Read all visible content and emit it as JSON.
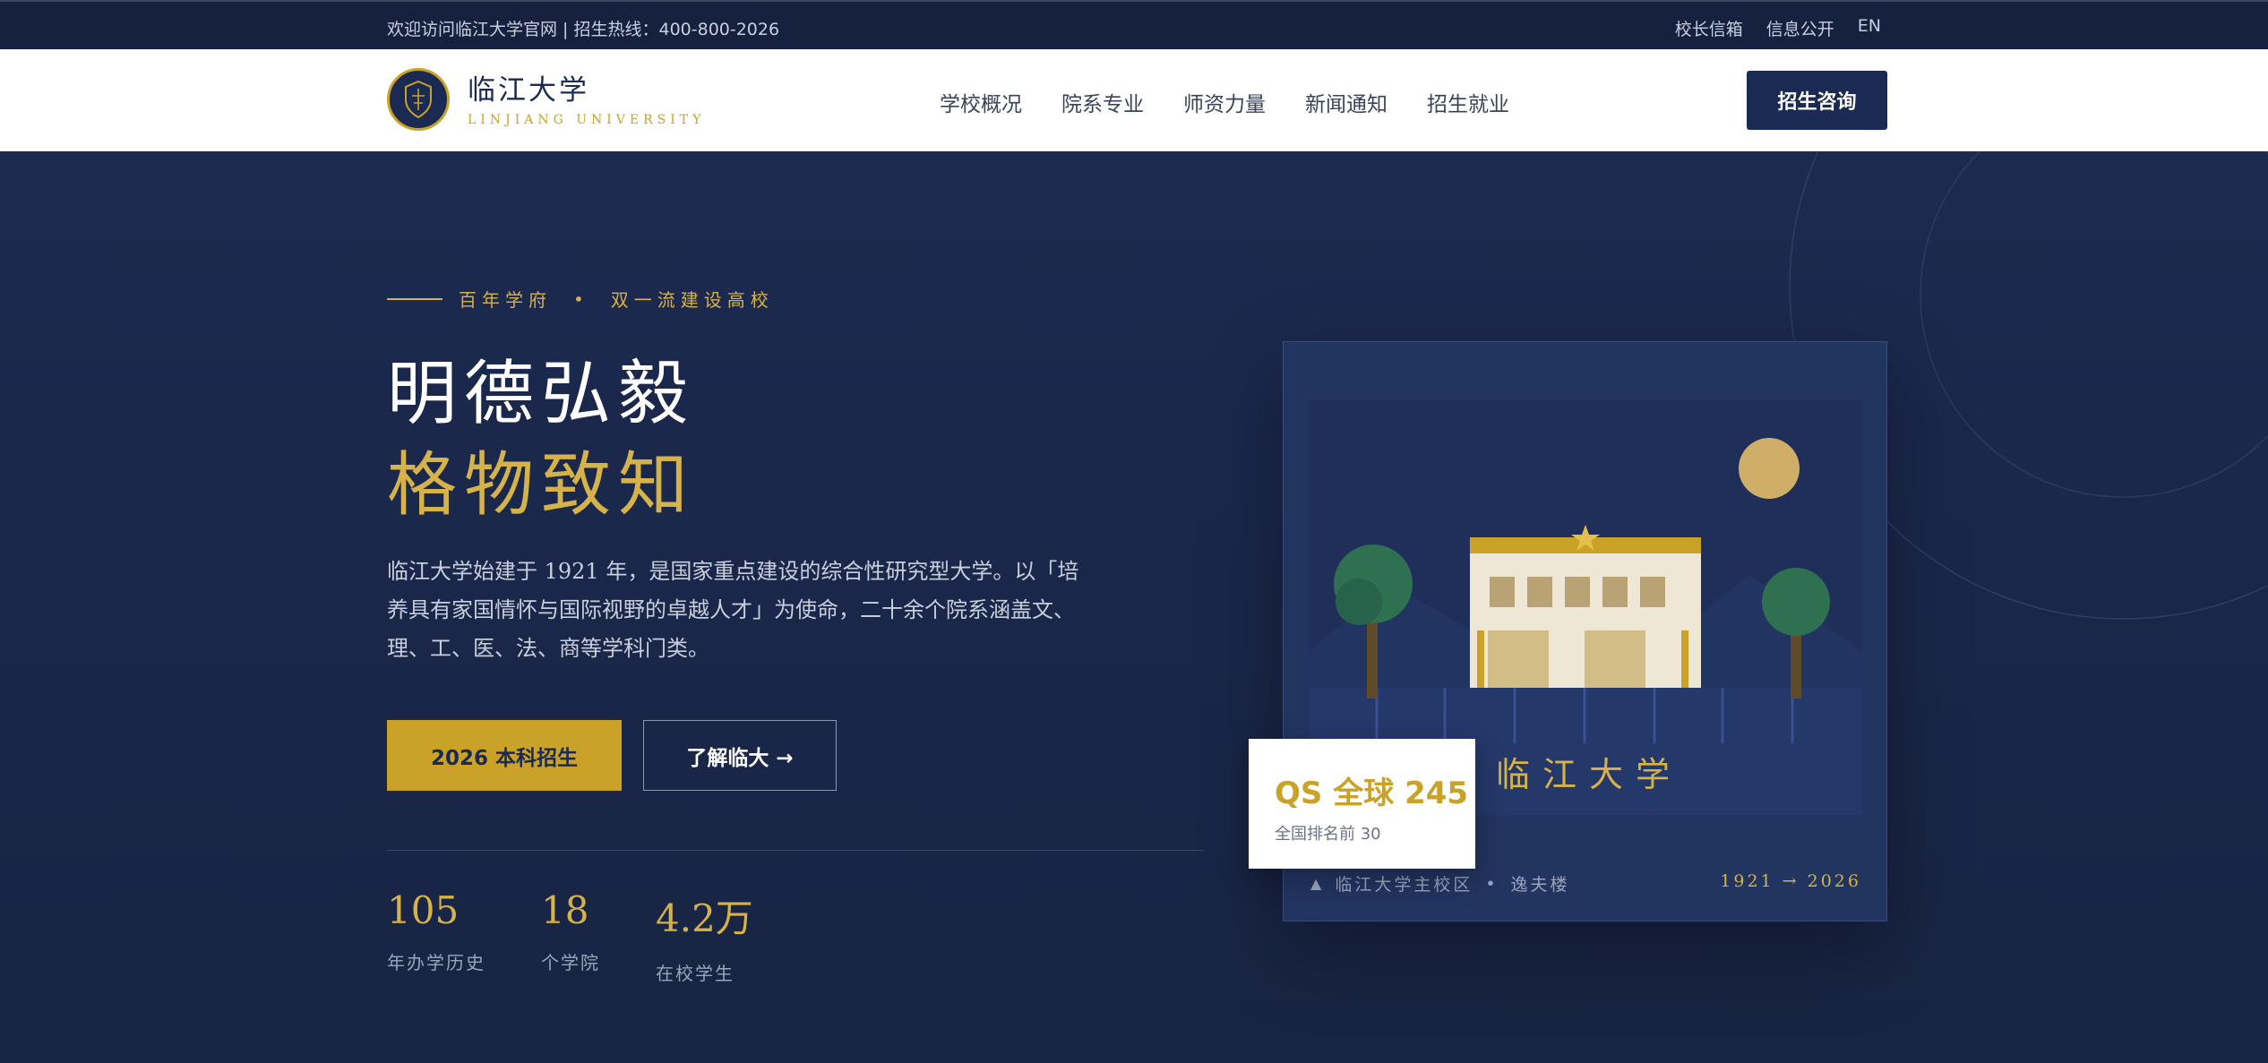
{
  "topbar": {
    "welcome": "欢迎访问临江大学官网 | 招生热线：400-800-2026",
    "links": [
      "校长信箱",
      "信息公开",
      "EN"
    ]
  },
  "brand": {
    "name_cn": "临江大学",
    "name_en": "LINJIANG UNIVERSITY",
    "emblem_icon": "shield-emblem-icon"
  },
  "nav": {
    "items": [
      "学校概况",
      "院系专业",
      "师资力量",
      "新闻通知",
      "招生就业"
    ],
    "cta": "招生咨询"
  },
  "hero": {
    "tag_left": "百年学府",
    "tag_dot": "•",
    "tag_right": "双一流建设高校",
    "title_line1": "明德弘毅",
    "title_line2": "格物致知",
    "intro": "临江大学始建于 1921 年，是国家重点建设的综合性研究型大学。以「培养具有家国情怀与国际视野的卓越人才」为使命，二十余个院系涵盖文、理、工、医、法、商等学科门类。",
    "btn_primary": "2026 本科招生",
    "btn_secondary": "了解临大 →"
  },
  "stats": [
    {
      "value": "105",
      "label": "年办学历史"
    },
    {
      "value": "18",
      "label": "个学院"
    },
    {
      "value": "4.2万",
      "label": "在校学生"
    }
  ],
  "card": {
    "campus_name": "临江大学",
    "location": "临江大学主校区",
    "dot": "•",
    "building": "逸夫楼",
    "years": "1921 → 2026"
  },
  "badge": {
    "rank": "QS 全球 245",
    "sub": "全国排名前 30"
  },
  "colors": {
    "navy": "#1b2a52",
    "gold": "#c9a227",
    "hero_bg": "#1c2a50"
  }
}
